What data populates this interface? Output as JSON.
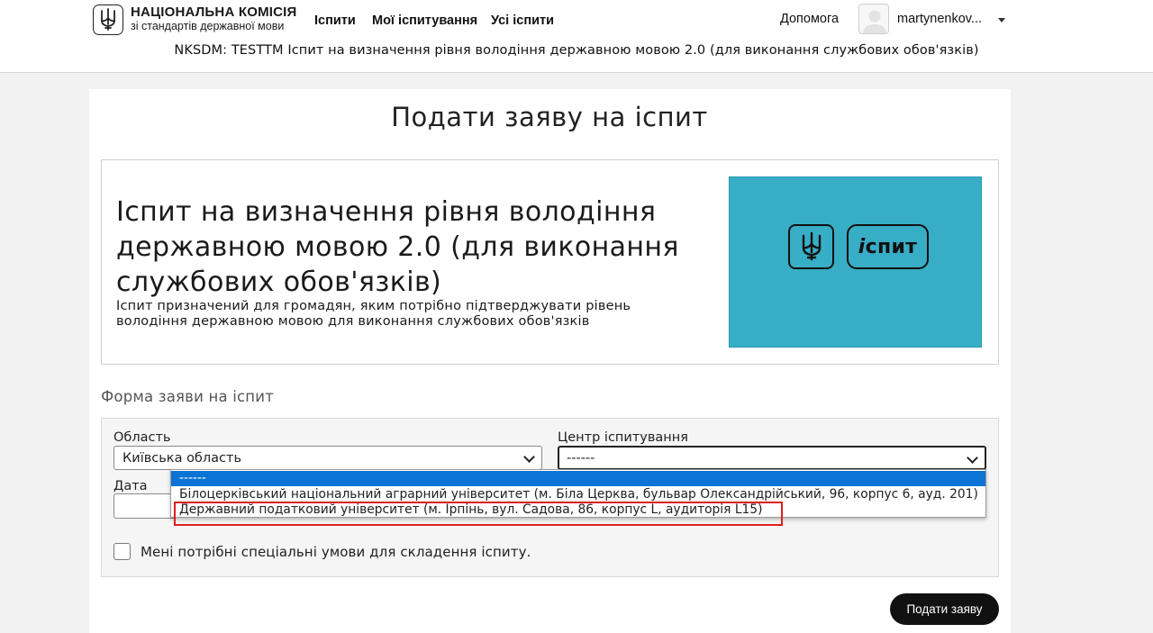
{
  "header": {
    "logo_title": "НАЦІОНАЛЬНА КОМІСІЯ",
    "logo_subtitle": "зі стандартів державної мови",
    "logo_icon": "trident-icon",
    "nav": [
      "Іспити",
      "Мої іспитування",
      "Усі іспити"
    ],
    "help": "Допомога",
    "username": "martynenkov...",
    "course_title": "NKSDM: TESTTM Іспит на визначення рівня володіння державною мовою 2.0 (для виконання службових обов'язків)"
  },
  "page": {
    "title": "Подати заяву на іспит"
  },
  "banner": {
    "exam_name": "Іспит на визначення рівня володіння державною мовою 2.0 (для виконання службових обов'язків)",
    "exam_description": "Іспит призначений для громадян, яким потрібно підтверджувати рівень володіння державною мовою для виконання службових обов'язків",
    "image_text": "іспит",
    "image_bg_color": "#37aec6"
  },
  "form": {
    "heading": "Форма заяви на іспит",
    "region_label": "Область",
    "region_value": "Київська область",
    "center_label": "Центр іспитування",
    "center_value": "------",
    "date_label": "Дата",
    "dropdown_options": [
      "------",
      "Білоцерківський національний аграрний університет (м. Біла Церква, бульвар Олександрійський, 96, корпус 6, ауд. 201)",
      "Державний податковий університет (м. Ірпінь, вул. Садова, 86, корпус L, аудиторія L15)"
    ],
    "selected_option_index": 0,
    "special_conditions_label": "Мені потрібні спеціальні умови для складення іспиту.",
    "special_conditions_checked": false,
    "submit_label": "Подати заяву"
  },
  "colors": {
    "selected_option": "#0b74d4",
    "highlight_annotation": "#e01e1e",
    "submit_button": "#111111"
  }
}
